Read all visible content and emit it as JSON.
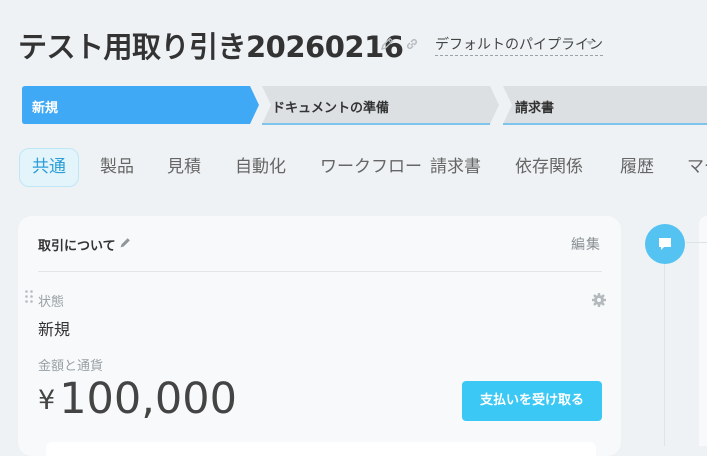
{
  "header": {
    "title": "テスト用取り引き20260216",
    "pipeline": "デフォルトのパイプライン"
  },
  "stages": [
    {
      "label": "新規",
      "active": true
    },
    {
      "label": "ドキュメントの準備",
      "active": false
    },
    {
      "label": "請求書",
      "active": false
    }
  ],
  "tabs": [
    {
      "label": "共通",
      "active": true
    },
    {
      "label": "製品"
    },
    {
      "label": "見積"
    },
    {
      "label": "自動化"
    },
    {
      "label": "ワークフロー"
    },
    {
      "label": "請求書"
    },
    {
      "label": "依存関係"
    },
    {
      "label": "履歴"
    },
    {
      "label": "マー"
    }
  ],
  "card": {
    "title": "取引について",
    "edit": "編集",
    "status_label": "状態",
    "status_value": "新規",
    "amount_label": "金額と通貨",
    "currency_symbol": "¥",
    "amount": "100,000",
    "pay_button": "支払いを受け取る"
  },
  "colors": {
    "accent": "#3bc8f5",
    "stage_active": "#3fa9f5",
    "stage_inactive": "#dde0e3",
    "tab_active_text": "#2d9fd8"
  },
  "icons": [
    "pencil-icon",
    "link-icon",
    "chevron-down-icon",
    "drag-handle-icon",
    "gear-icon",
    "chat-icon"
  ]
}
